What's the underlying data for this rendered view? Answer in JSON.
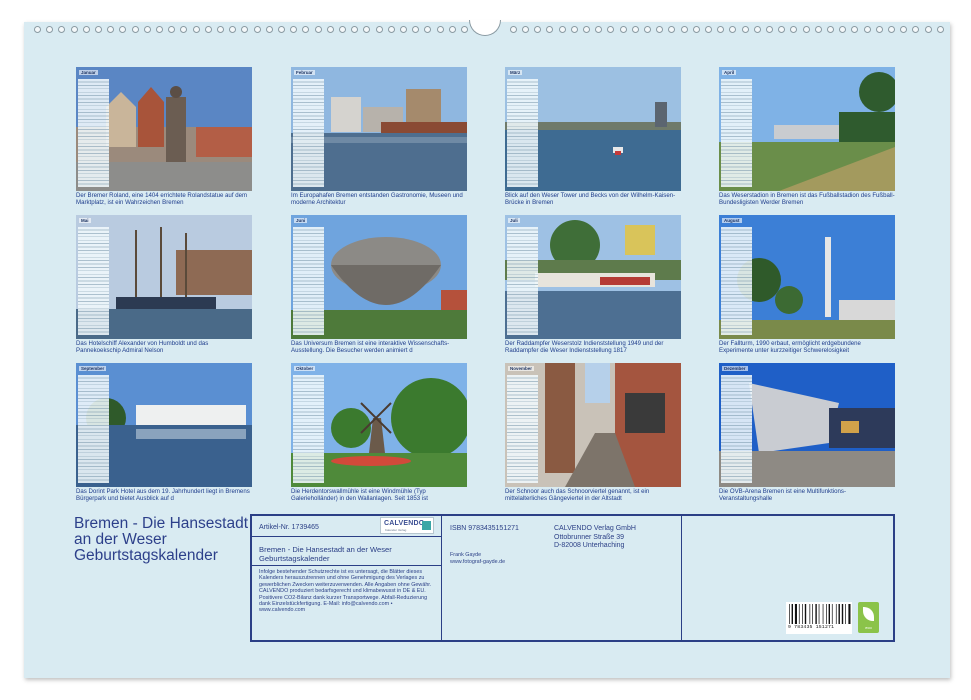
{
  "calendar_title": "Bremen - Die Hansestadt an der Weser Geburtstagskalender",
  "months": [
    {
      "name": "Januar",
      "caption": "Der Bremer Roland, eine 1404 errichtete Rolandstatue auf dem Marktplatz, ist ein Wahrzeichen Bremen"
    },
    {
      "name": "Februar",
      "caption": "Im Europahafen Bremen entstanden Gastronomie, Museen und moderne Architektur"
    },
    {
      "name": "März",
      "caption": "Blick auf den Weser Tower und Becks von der Wilhelm-Kaisen-Brücke in Bremen"
    },
    {
      "name": "April",
      "caption": "Das Weserstadion in Bremen ist das Fußballstadion des Fußball-Bundesligisten Werder Bremen"
    },
    {
      "name": "Mai",
      "caption": "Das Hotelschiff Alexander von Humboldt und das Pannekoekschip Admiral Nelson"
    },
    {
      "name": "Juni",
      "caption": "Das Universum Bremen ist eine interaktive Wissenschafts-Ausstellung. Die Besucher werden animiert d"
    },
    {
      "name": "Juli",
      "caption": "Der Raddampfer Weserstolz Indienststellung 1949 und der Raddampfer die Weser Indienststellung 1817"
    },
    {
      "name": "August",
      "caption": "Der Fallturm, 1990 erbaut, ermöglicht erdgebundene Experimente unter kurzzeitiger Schwerelosigkeit"
    },
    {
      "name": "September",
      "caption": "Das Dorint Park Hotel aus dem 19. Jahrhundert liegt in Bremens Bürgerpark und bietet Ausblick auf d"
    },
    {
      "name": "Oktober",
      "caption": "Die Herdentorswallmühle ist eine Windmühle (Typ Galerieholländer) in den Wallanlagen. Seit 1853 ist"
    },
    {
      "name": "November",
      "caption": "Der Schnoor auch das Schnoorviertel genannt, ist ein mittelalterliches Gängeviertel in der Altstadt"
    },
    {
      "name": "Dezember",
      "caption": "Die ÖVB-Arena Bremen ist eine Multifunktions-Veranstaltungshalle"
    }
  ],
  "imprint": {
    "article_no": "Artikel-Nr. 1739465",
    "logo_text": "CALVENDO",
    "logo_sub": "Kalender Verlag",
    "title": "Bremen - Die Hansestadt an der Weser Geburtstagskalender",
    "legal": "Infolge bestehender Schutzrechte ist es untersagt, die Blätter dieses Kalenders herauszutrennen und ohne Genehmigung des Verlages zu gewerblichen Zwecken weiterzuverwenden. Alle Angaben ohne Gewähr. CALVENDO produziert bedarfsgerecht und klimabewusst in DE & EU. Positivere CO2-Bilanz dank kurzer Transportwege. Abfall-Reduzierung dank Einzelstückfertigung. E-Mail: info@calvendo.com • www.calvendo.com",
    "isbn": "ISBN 9783435151271",
    "publisher_lines": [
      "CALVENDO Verlag GmbH",
      "Ottobrunner Straße 39",
      "D-82008 Unterhaching"
    ],
    "author_lines": [
      "Frank Gayde",
      "www.fotograf-gayde.de"
    ],
    "barcode_number": "9 783435 151271",
    "eco_label": "eco"
  }
}
